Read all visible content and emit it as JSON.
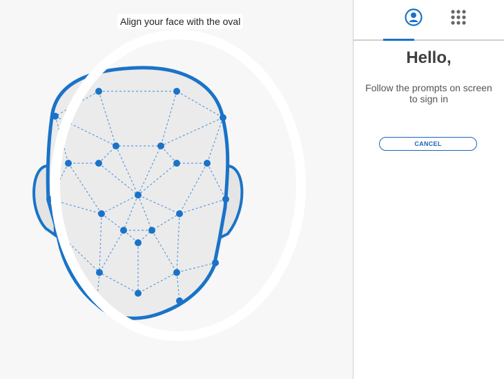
{
  "camera": {
    "instruction": "Align your face with the oval",
    "accent_color": "#1a73c8"
  },
  "tabs": [
    {
      "name": "face-recognition",
      "icon": "user-circle-icon",
      "active": true
    },
    {
      "name": "pin-keypad",
      "icon": "keypad-grid-icon",
      "active": false
    }
  ],
  "panel": {
    "greeting": "Hello,",
    "subtitle": "Follow the prompts on screen to sign in",
    "cancel_label": "CANCEL"
  }
}
